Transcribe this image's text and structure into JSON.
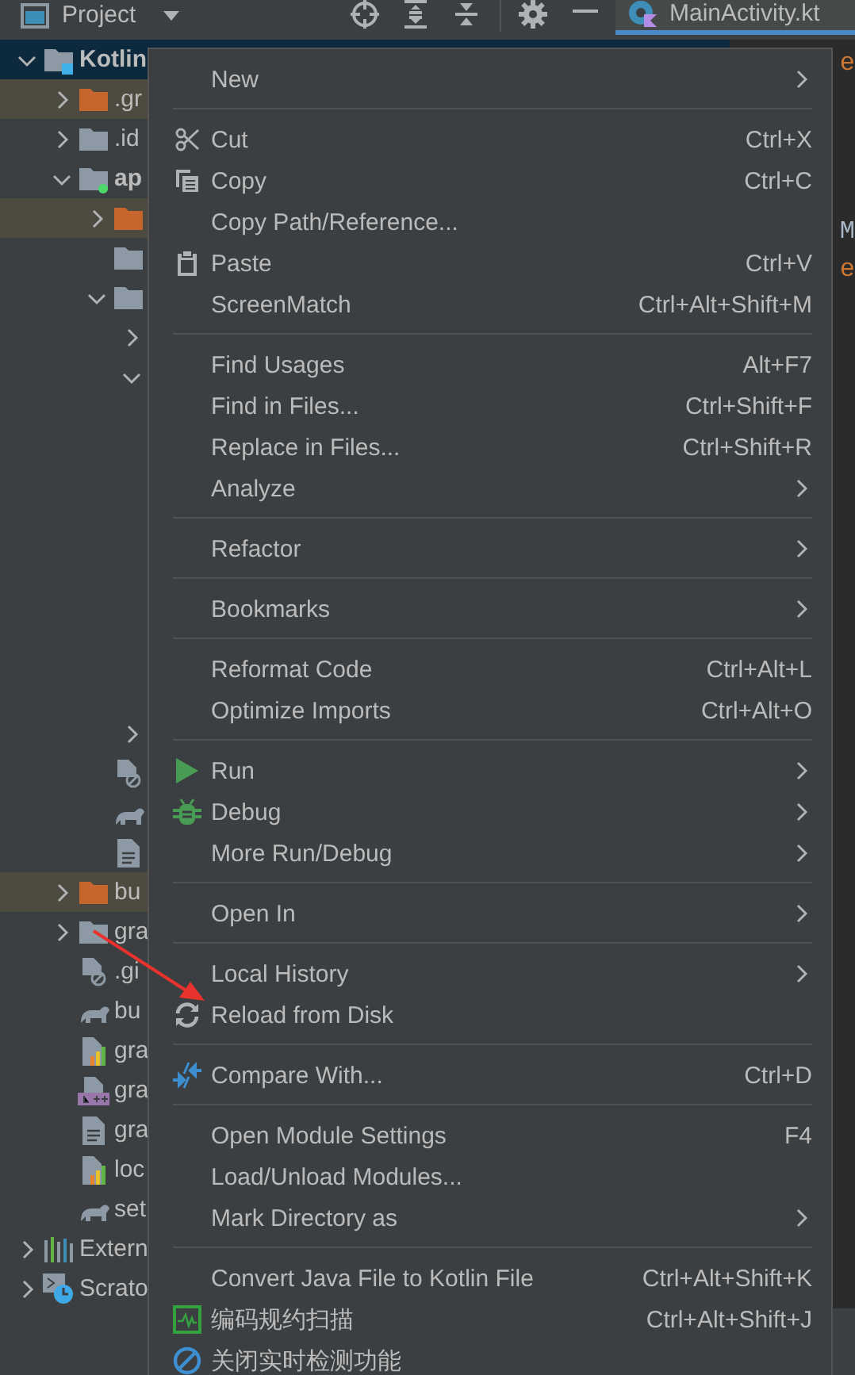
{
  "toolbar": {
    "panel_title": "Project",
    "tab": {
      "label": "MainActivity.kt",
      "selected": true
    }
  },
  "tree": [
    {
      "label": "Kotlin",
      "kind": "module",
      "selected": true,
      "expanded": true,
      "children": [
        {
          "label": ".gr",
          "kind": "excluded",
          "selected": false,
          "expanded": false
        },
        {
          "label": ".id",
          "kind": "folder",
          "selected": false,
          "expanded": false
        },
        {
          "label": "ap",
          "kind": "app",
          "selected": false,
          "expanded": true,
          "children": [
            {
              "kind": "excluded",
              "selected": false,
              "expanded": false
            },
            {
              "kind": "folder",
              "selected": false
            },
            {
              "kind": "folder",
              "selected": false,
              "expanded": true,
              "children": [
                {
                  "selected": false,
                  "expanded": false
                },
                {
                  "selected": false,
                  "expanded": true
                },
                {
                  "selected": false,
                  "expanded": false
                }
              ]
            },
            {
              "kind": "ignored",
              "selected": false
            },
            {
              "kind": "gradle",
              "selected": false
            },
            {
              "kind": "file",
              "selected": false
            }
          ]
        },
        {
          "label": "bu",
          "kind": "excluded",
          "selected": false,
          "expanded": false
        },
        {
          "label": "gra",
          "kind": "folder",
          "selected": false,
          "expanded": false
        },
        {
          "label": ".gi",
          "kind": "ignored",
          "selected": false
        },
        {
          "label": "bu",
          "kind": "gradle",
          "selected": false
        },
        {
          "label": "gra",
          "kind": "props",
          "selected": false
        },
        {
          "label": "gra",
          "kind": "cpp",
          "selected": false
        },
        {
          "label": "gra",
          "kind": "file",
          "selected": false
        },
        {
          "label": "loc",
          "kind": "props",
          "selected": false
        },
        {
          "label": "set",
          "kind": "gradle",
          "selected": false
        }
      ]
    },
    {
      "label": "Extern",
      "kind": "libraries",
      "selected": false,
      "expanded": false
    },
    {
      "label": "Scrato",
      "kind": "scratches",
      "selected": false,
      "expanded": false
    }
  ],
  "editor": [
    {
      "text": "e",
      "color": "#cc7832"
    },
    {
      "text": "M",
      "color": "#a9b7c6"
    },
    {
      "text": "e",
      "color": "#cc7832"
    }
  ],
  "context_menu": [
    [
      {
        "label": "New",
        "submenu": true
      }
    ],
    [
      {
        "label": "Cut",
        "kind": "cut",
        "shortcut": "Ctrl+X"
      },
      {
        "label": "Copy",
        "kind": "copy",
        "shortcut": "Ctrl+C"
      },
      {
        "label": "Copy Path/Reference..."
      },
      {
        "label": "Paste",
        "kind": "paste",
        "shortcut": "Ctrl+V"
      },
      {
        "label": "ScreenMatch",
        "shortcut": "Ctrl+Alt+Shift+M"
      }
    ],
    [
      {
        "label": "Find Usages",
        "shortcut": "Alt+F7"
      },
      {
        "label": "Find in Files...",
        "shortcut": "Ctrl+Shift+F"
      },
      {
        "label": "Replace in Files...",
        "shortcut": "Ctrl+Shift+R"
      },
      {
        "label": "Analyze",
        "submenu": true
      }
    ],
    [
      {
        "label": "Refactor",
        "submenu": true
      }
    ],
    [
      {
        "label": "Bookmarks",
        "submenu": true
      }
    ],
    [
      {
        "label": "Reformat Code",
        "shortcut": "Ctrl+Alt+L"
      },
      {
        "label": "Optimize Imports",
        "shortcut": "Ctrl+Alt+O"
      }
    ],
    [
      {
        "label": "Run",
        "kind": "run",
        "submenu": true
      },
      {
        "label": "Debug",
        "kind": "debug",
        "submenu": true
      },
      {
        "label": "More Run/Debug",
        "submenu": true
      }
    ],
    [
      {
        "label": "Open In",
        "submenu": true
      }
    ],
    [
      {
        "label": "Local History",
        "submenu": true
      },
      {
        "label": "Reload from Disk",
        "kind": "reload"
      }
    ],
    [
      {
        "label": "Compare With...",
        "kind": "compare",
        "shortcut": "Ctrl+D"
      }
    ],
    [
      {
        "label": "Open Module Settings",
        "shortcut": "F4"
      },
      {
        "label": "Load/Unload Modules..."
      },
      {
        "label": "Mark Directory as",
        "submenu": true
      }
    ],
    [
      {
        "label": "Convert Java File to Kotlin File",
        "shortcut": "Ctrl+Alt+Shift+K"
      },
      {
        "label": "编码规约扫描",
        "kind": "scan",
        "shortcut": "Ctrl+Alt+Shift+J"
      },
      {
        "label": "关闭实时检测功能",
        "kind": "disable"
      }
    ]
  ]
}
